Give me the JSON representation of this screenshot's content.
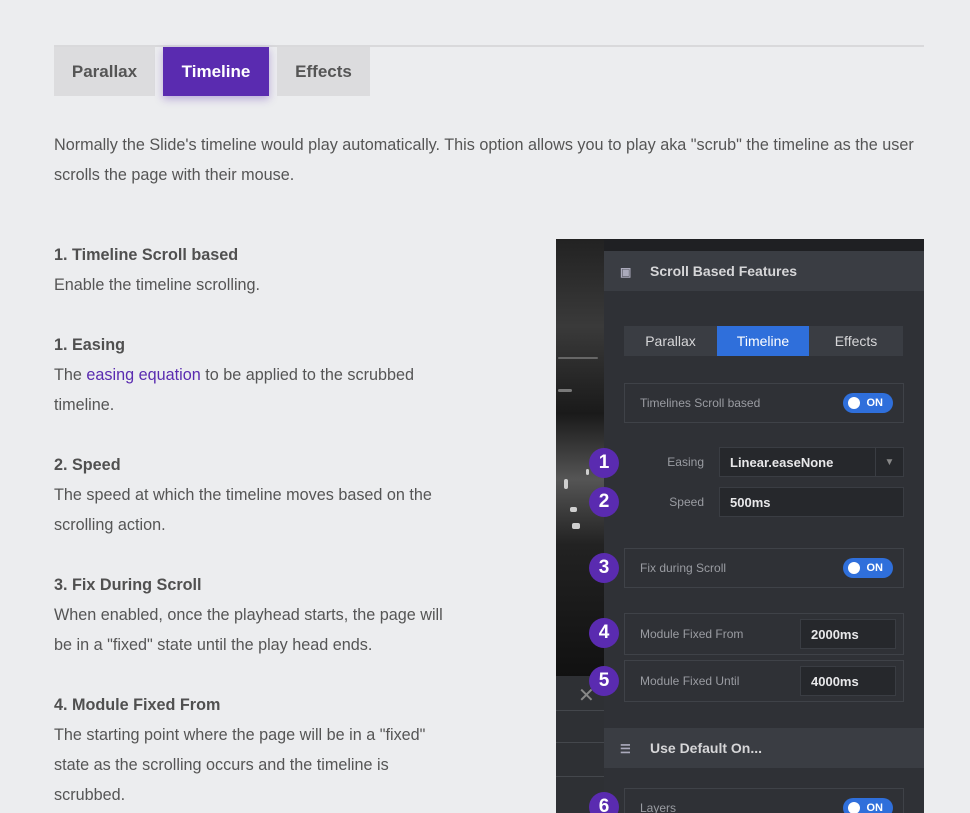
{
  "tabs": [
    "Parallax",
    "Timeline",
    "Effects"
  ],
  "active_tab": "Timeline",
  "intro": "Normally the Slide's timeline would play automatically. This option allows you to play aka \"scrub\" the timeline as the user scrolls the page with their mouse.",
  "items": [
    {
      "title": "1. Timeline Scroll based",
      "desc": "Enable the timeline scrolling."
    },
    {
      "title": "1. Easing",
      "desc_before": "The ",
      "link": "easing equation",
      "desc_after": " to be applied to the scrubbed timeline."
    },
    {
      "title": "2. Speed",
      "desc": "The speed at which the timeline moves based on the scrolling action."
    },
    {
      "title": "3. Fix During Scroll",
      "desc": "When enabled, once the playhead starts, the page will be in a \"fixed\" state until the play head ends."
    },
    {
      "title": "4. Module Fixed From",
      "desc": "The starting point where the page will be in a \"fixed\" state as the scrolling occurs and the timeline is scrubbed."
    }
  ],
  "panel": {
    "section1": "Scroll Based Features",
    "tabs": [
      "Parallax",
      "Timeline",
      "Effects"
    ],
    "timelines_scroll_label": "Timelines Scroll based",
    "toggle_on": "ON",
    "easing_label": "Easing",
    "easing_value": "Linear.easeNone",
    "speed_label": "Speed",
    "speed_value": "500ms",
    "fix_label": "Fix during Scroll",
    "fixed_from_label": "Module Fixed From",
    "fixed_from_value": "2000ms",
    "fixed_until_label": "Module Fixed Until",
    "fixed_until_value": "4000ms",
    "section2": "Use Default On...",
    "layers_label": "Layers",
    "close": "✕"
  },
  "badges": [
    "1",
    "2",
    "3",
    "4",
    "5",
    "6"
  ],
  "colors": {
    "accent": "#5a2bb0",
    "toggle": "#2f6fdb"
  }
}
